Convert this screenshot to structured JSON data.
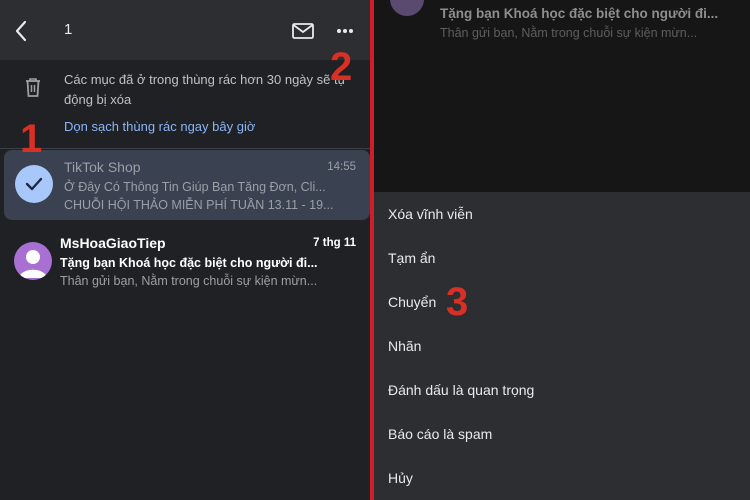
{
  "left": {
    "header": {
      "selected_count": "1"
    },
    "trash_notice": {
      "text": "Các mục đã ở trong thùng rác hơn 30 ngày sẽ tự động bị xóa",
      "link": "Dọn sạch thùng rác ngay bây giờ"
    },
    "emails": [
      {
        "sender": "TikTok Shop",
        "time": "14:55",
        "subject": "Ở Đây Có Thông Tin Giúp Bạn Tăng Đơn, Cli...",
        "snippet": "CHUỖI HỘI THẢO MIỄN PHÍ TUẦN 13.11 - 19...",
        "selected": true
      },
      {
        "sender": "MsHoaGiaoTiep",
        "time": "7 thg 11",
        "subject": "Tặng bạn Khoá học đặc biệt cho người đi...",
        "snippet": "Thân gửi bạn, Nằm trong chuỗi sự kiện mừn...",
        "avatar_color": "#a970d4"
      }
    ]
  },
  "steps": [
    "1",
    "2",
    "3"
  ],
  "right": {
    "background_email": {
      "subject": "Tặng bạn Khoá học đặc biệt cho người đi...",
      "snippet": "Thân gửi bạn, Nằm trong chuỗi sự kiện mừn..."
    },
    "menu": [
      "Xóa vĩnh viễn",
      "Tạm ẩn",
      "Chuyển",
      "Nhãn",
      "Đánh dấu là quan trọng",
      "Báo cáo là spam",
      "Hủy"
    ]
  },
  "colors": {
    "accent_link": "#8ab4f8",
    "annotation_red": "#d93025",
    "divider_red": "#cc1f2a",
    "selected_row": "#3a4150"
  }
}
